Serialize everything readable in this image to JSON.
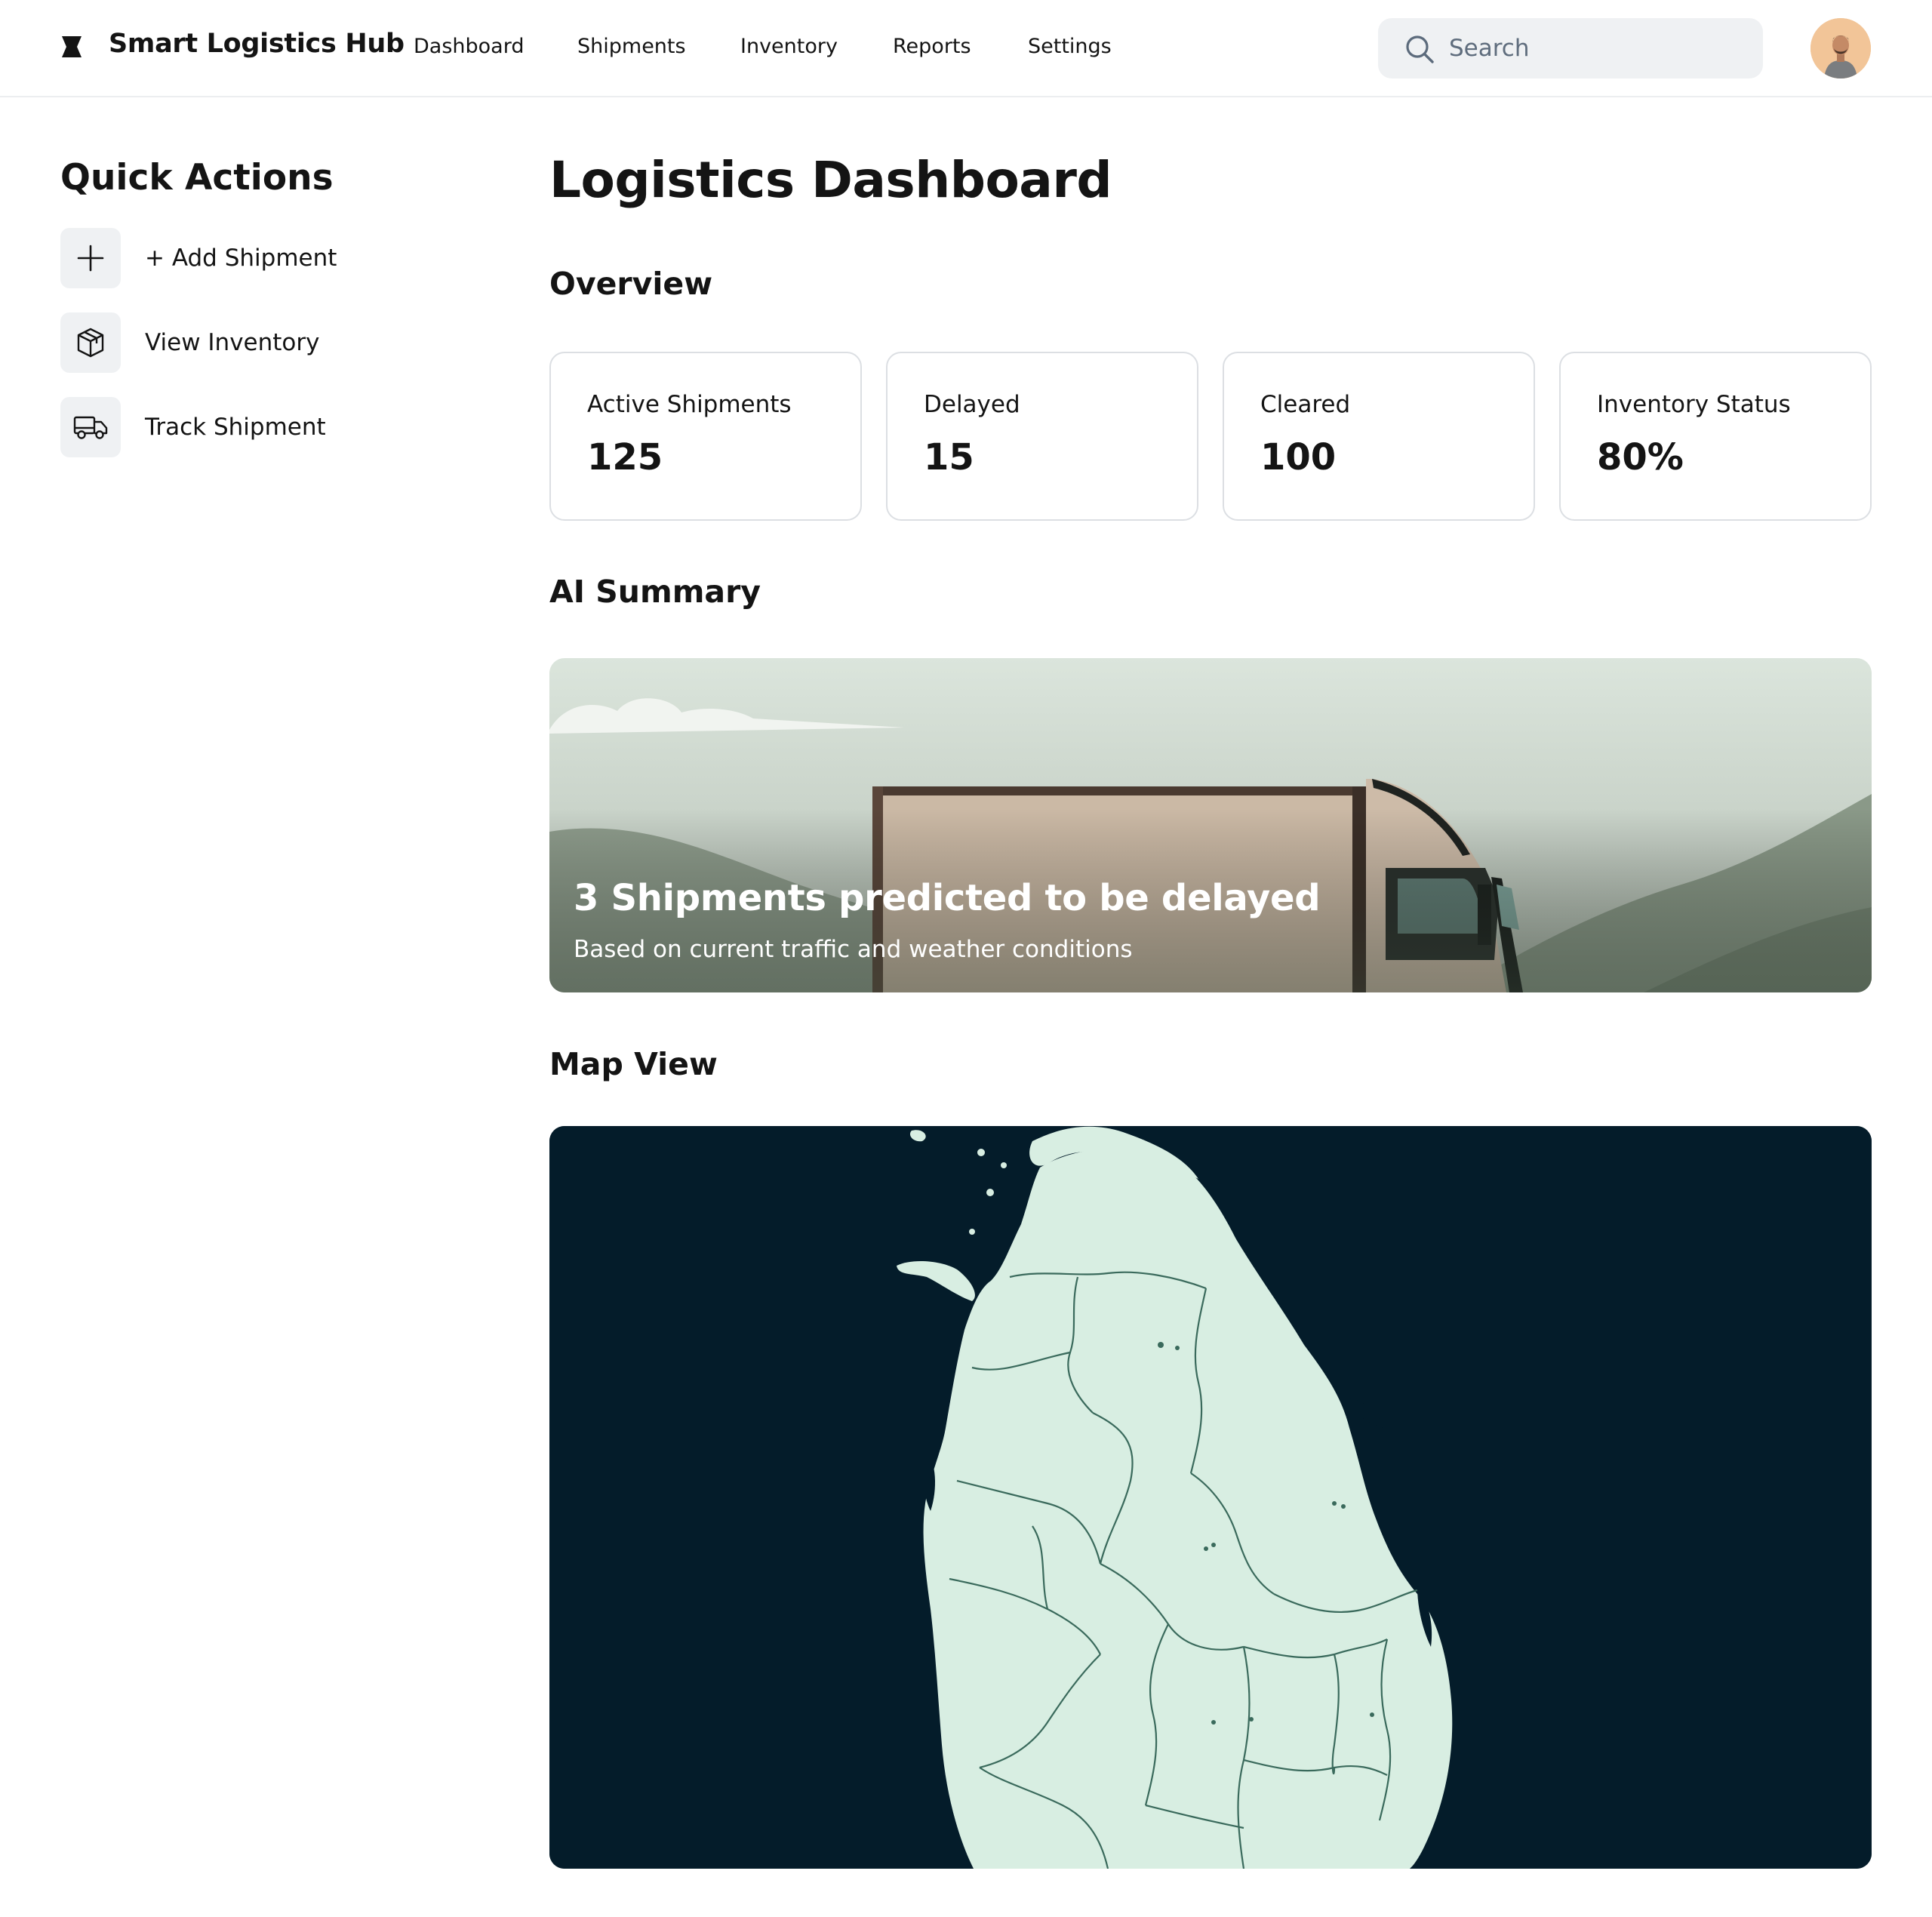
{
  "header": {
    "app_title": "Smart Logistics Hub",
    "nav": [
      "Dashboard",
      "Shipments",
      "Inventory",
      "Reports",
      "Settings"
    ],
    "search_placeholder": "Search"
  },
  "sidebar": {
    "title": "Quick Actions",
    "items": [
      {
        "label": "+ Add Shipment",
        "icon": "plus-icon"
      },
      {
        "label": "View Inventory",
        "icon": "box-icon"
      },
      {
        "label": "Track Shipment",
        "icon": "truck-icon"
      }
    ]
  },
  "main": {
    "title": "Logistics Dashboard",
    "overview_title": "Overview",
    "stats": [
      {
        "label": "Active Shipments",
        "value": "125"
      },
      {
        "label": "Delayed",
        "value": "15"
      },
      {
        "label": "Cleared",
        "value": "100"
      },
      {
        "label": "Inventory Status",
        "value": "80%"
      }
    ],
    "ai_summary_title": "AI Summary",
    "ai_summary": {
      "headline": "3 Shipments predicted to be delayed",
      "subtext": "Based on current traffic and weather conditions"
    },
    "map_title": "Map View"
  },
  "colors": {
    "text": "#141414",
    "card_border": "#dcdfe3",
    "icon_bg": "#eff1f3",
    "map_sea": "#041c2a",
    "map_land": "#d8eee2"
  }
}
